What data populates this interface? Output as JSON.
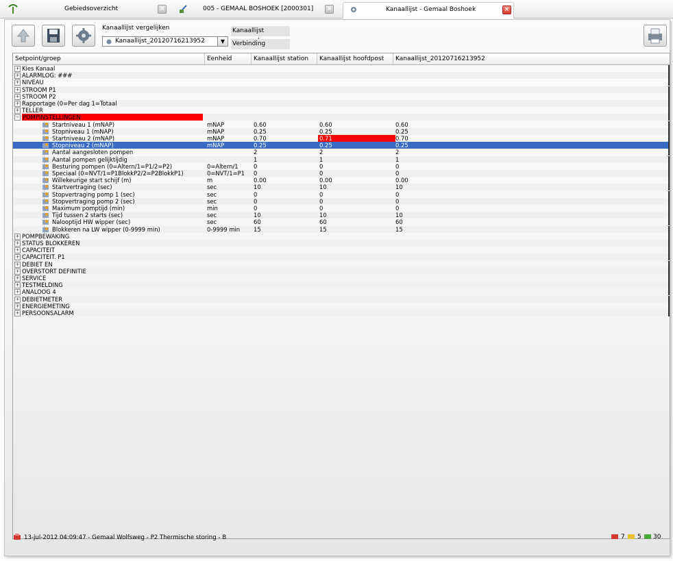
{
  "tabs": [
    {
      "label": "Gebiedsoverzicht",
      "icon": "antenna-icon",
      "active": false
    },
    {
      "label": "005 - GEMAAL BOSHOEK [2000301]",
      "icon": "pump-icon",
      "active": false
    },
    {
      "label": "Kanaallijst - Gemaal Boshoek",
      "icon": "gear-icon",
      "active": true
    }
  ],
  "toolbar": {
    "compare_label": "Kanaallijst vergelijken",
    "combo_value": "Kanaallijst_20120716213952",
    "status_opened": "Kanaallijst geopend",
    "status_connection": "Verbinding",
    "buttons": [
      "upload-icon",
      "save-icon",
      "settings-gear-icon"
    ],
    "print_icon": "printer-icon"
  },
  "grid": {
    "columns": [
      "Setpoint/groep",
      "Eenheid",
      "Kanaallijst station",
      "Kanaallijst hoofdpost",
      "Kanaallijst_20120716213952"
    ],
    "groups_top": [
      "Kies Kanaal",
      "ALARMLOG: ###",
      "NIVEAU",
      "STROOM P1",
      "STROOM P2",
      "Rapportage (0=Per dag 1=Totaal",
      "TELLER"
    ],
    "expanded_group": "POMPINSTELLINGEN",
    "rows": [
      {
        "name": "Startniveau 1 (mNAP)",
        "unit": "mNAP",
        "station": "0.60",
        "hoofdpost": "0.60",
        "file": "0.60"
      },
      {
        "name": "Stopniveau 1 (mNAP)",
        "unit": "mNAP",
        "station": "0.25",
        "hoofdpost": "0.25",
        "file": "0.25"
      },
      {
        "name": "Startniveau 2 (mNAP)",
        "unit": "mNAP",
        "station": "0.70",
        "hoofdpost": "0.71",
        "file": "0.70"
      },
      {
        "name": "Stopniveau 2 (mNAP)",
        "unit": "mNAP",
        "station": "0.25",
        "hoofdpost": "0.25",
        "file": "0.25"
      },
      {
        "name": "Aantal aangesloten pompen",
        "unit": "",
        "station": "2",
        "hoofdpost": "2",
        "file": "2"
      },
      {
        "name": "Aantal pompen gelijktijdig",
        "unit": "",
        "station": "1",
        "hoofdpost": "1",
        "file": "1"
      },
      {
        "name": "Besturing pompen (0=Altern/1=P1/2=P2)",
        "unit": "0=Altern/1",
        "station": "0",
        "hoofdpost": "0",
        "file": "0"
      },
      {
        "name": "Speciaal (0=NVT/1=P1BlokkP2/2=P2BlokkP1)",
        "unit": "0=NVT/1=P1",
        "station": "0",
        "hoofdpost": "0",
        "file": "0"
      },
      {
        "name": "Willekeurige start schijf (m)",
        "unit": "m",
        "station": "0.00",
        "hoofdpost": "0.00",
        "file": "0.00"
      },
      {
        "name": "Startvertraging (sec)",
        "unit": "sec",
        "station": "10",
        "hoofdpost": "10",
        "file": "10"
      },
      {
        "name": "Stopvertraging pomp 1 (sec)",
        "unit": "sec",
        "station": "0",
        "hoofdpost": "0",
        "file": "0"
      },
      {
        "name": "Stopvertraging pomp 2 (sec)",
        "unit": "sec",
        "station": "0",
        "hoofdpost": "0",
        "file": "0"
      },
      {
        "name": "Maximum pomptijd (min)",
        "unit": "min",
        "station": "0",
        "hoofdpost": "0",
        "file": "0"
      },
      {
        "name": "Tijd tussen 2 starts (sec)",
        "unit": "sec",
        "station": "10",
        "hoofdpost": "10",
        "file": "10"
      },
      {
        "name": "Nalooptijd HW wipper (sec)",
        "unit": "sec",
        "station": "60",
        "hoofdpost": "60",
        "file": "60"
      },
      {
        "name": "Blokkeren na LW wipper (0-9999 min)",
        "unit": "0-9999 min",
        "station": "15",
        "hoofdpost": "15",
        "file": "15"
      }
    ],
    "selected_row": "Stopniveau 2 (mNAP)",
    "mismatch_row": "Startniveau 2 (mNAP)",
    "groups_bottom": [
      "POMPBEWAKING",
      "STATUS BLOKKEREN",
      "CAPACITEIT",
      "CAPACITEIT. P1",
      "DEBIET EN",
      "OVERSTORT DEFINITIE",
      "SERVICE",
      "TESTMELDING",
      "ANALOOG 4",
      "DEBIETMETER",
      "ENERGIEMETING",
      "PERSOONSALARM"
    ]
  },
  "alarm_bar": {
    "message": "13-jul-2012 04:09:47 - Gemaal Wolfsweg - P2 Thermische storing - B",
    "counters": [
      {
        "icon": "alarm-red-icon",
        "count": "7"
      },
      {
        "icon": "alarm-yellow-icon",
        "count": "5"
      },
      {
        "icon": "alarm-green-icon",
        "count": "30"
      }
    ]
  },
  "colors": {
    "selection": "#3a6bc4",
    "mismatch": "#ff0000",
    "group_highlight": "#ff0000"
  }
}
